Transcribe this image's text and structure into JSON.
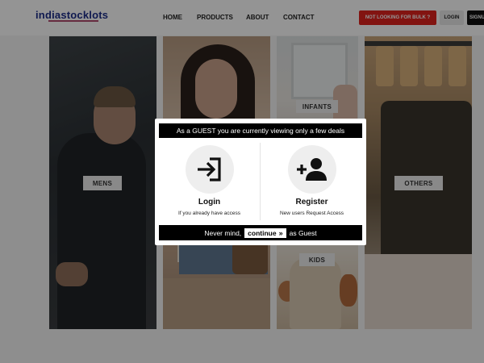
{
  "header": {
    "logo": "indiastocklots",
    "nav": {
      "home": "HOME",
      "products": "PRODUCTS",
      "about": "ABOUT",
      "contact": "CONTACT"
    },
    "bulk_button": "NOT LOOKING FOR BULK ?",
    "login_button": "LOGIN",
    "signup_button": "SIGNU"
  },
  "categories": {
    "mens": "MENS",
    "infants": "INFANTS",
    "kids": "KIDS",
    "others": "OTHERS"
  },
  "modal": {
    "banner": "As a GUEST you are currently viewing only a few deals",
    "login": {
      "title": "Login",
      "subtitle": "If you already have access",
      "icon": "login-icon"
    },
    "register": {
      "title": "Register",
      "subtitle": "New users Request Access",
      "icon": "add-user-icon"
    },
    "footer": {
      "prefix": "Never mind,",
      "continue_label": "continue",
      "continue_icon": "double-chevron-right-icon",
      "suffix": "as Guest"
    }
  },
  "colors": {
    "brand": "#1c2e8a",
    "bulk_button": "#e0231e",
    "modal_bar": "#000000"
  }
}
